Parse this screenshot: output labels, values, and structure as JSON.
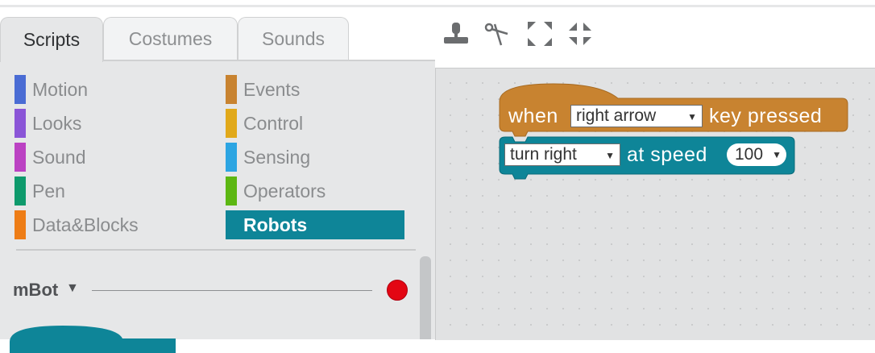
{
  "tabs": [
    {
      "label": "Scripts",
      "active": true
    },
    {
      "label": "Costumes",
      "active": false
    },
    {
      "label": "Sounds",
      "active": false
    }
  ],
  "toolbar": {
    "icons": [
      "stamp-icon",
      "cut-icon",
      "grow-icon",
      "shrink-icon"
    ]
  },
  "categories": {
    "left": [
      {
        "label": "Motion",
        "color": "#4a6cd4"
      },
      {
        "label": "Looks",
        "color": "#8a55d7"
      },
      {
        "label": "Sound",
        "color": "#bb42c3"
      },
      {
        "label": "Pen",
        "color": "#0e9a6c"
      },
      {
        "label": "Data&Blocks",
        "color": "#ee7d16"
      }
    ],
    "right": [
      {
        "label": "Events",
        "color": "#c88330"
      },
      {
        "label": "Control",
        "color": "#e1a91a"
      },
      {
        "label": "Sensing",
        "color": "#2ca5e2"
      },
      {
        "label": "Operators",
        "color": "#5cb712"
      },
      {
        "label": "Robots",
        "color": "#0e8598",
        "selected": true
      }
    ]
  },
  "device": {
    "label": "mBot",
    "status_color": "#e30613"
  },
  "script": {
    "hat": {
      "prefix": "when",
      "key": "right arrow",
      "suffix": "key pressed",
      "color": "#c88330"
    },
    "command": {
      "direction": "turn right",
      "middle": "at speed",
      "speed": "100",
      "color": "#0e8598"
    }
  }
}
